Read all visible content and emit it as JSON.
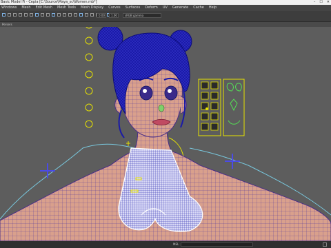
{
  "window": {
    "title": "Basic Model Fi - Cepia [C:\\Source\\Maya_sc\\Women.mb*]",
    "controls": [
      "–",
      "☐",
      "✕"
    ]
  },
  "menu": [
    "Windows",
    "Mesh",
    "Edit Mesh",
    "Mesh Tools",
    "Mesh Display",
    "Curves",
    "Surfaces",
    "Deform",
    "UV",
    "Generate",
    "Cache",
    "Help"
  ],
  "toolbar": {
    "field_a": "0.00",
    "field_b": "1.00",
    "colorspace": "sRGB gamma"
  },
  "panel": {
    "label": "Persers"
  },
  "status": {
    "label": "MEL"
  },
  "colors": {
    "viewport_bg": "#5d5d5d",
    "wireframe_blue": "#1a1aa8",
    "control_yellow": "#e8e400",
    "skin": "#d9a08c"
  },
  "icons": [
    "select-icon",
    "lasso-icon",
    "paint-icon",
    "move-icon",
    "rotate-icon",
    "scale-icon",
    "snap-icon"
  ]
}
